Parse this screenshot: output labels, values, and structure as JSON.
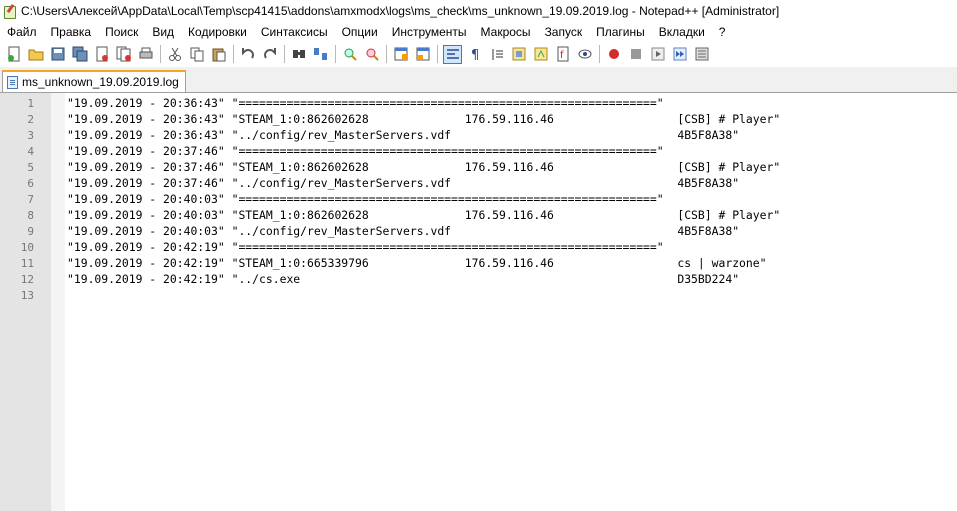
{
  "window": {
    "title": "C:\\Users\\Алексей\\AppData\\Local\\Temp\\scp41415\\addons\\amxmodx\\logs\\ms_check\\ms_unknown_19.09.2019.log - Notepad++ [Administrator]"
  },
  "menu": [
    "Файл",
    "Правка",
    "Поиск",
    "Вид",
    "Кодировки",
    "Синтаксисы",
    "Опции",
    "Инструменты",
    "Макросы",
    "Запуск",
    "Плагины",
    "Вкладки",
    "?"
  ],
  "toolbar_icons": [
    "new-file-icon",
    "open-file-icon",
    "save-icon",
    "save-all-icon",
    "close-icon",
    "close-all-icon",
    "print-icon",
    "|",
    "cut-icon",
    "copy-icon",
    "paste-icon",
    "|",
    "undo-icon",
    "redo-icon",
    "|",
    "find-icon",
    "replace-icon",
    "|",
    "zoom-in-icon",
    "zoom-out-icon",
    "|",
    "sync-vertical-icon",
    "sync-horizontal-icon",
    "|",
    "word-wrap-icon",
    "show-all-chars-icon",
    "indent-guide-icon",
    "document-map-icon",
    "function-list-icon",
    "folder-workspace-icon",
    "monitoring-icon",
    "|",
    "record-macro-icon",
    "stop-macro-icon",
    "play-macro-icon",
    "run-macro-multiple-icon",
    "save-macro-icon"
  ],
  "tab": {
    "label": "ms_unknown_19.09.2019.log"
  },
  "editor": {
    "lines": [
      {
        "n": "1",
        "text": "\"19.09.2019 - 20:36:43\" \"=============================================================\""
      },
      {
        "n": "2",
        "text": "\"19.09.2019 - 20:36:43\" \"STEAM_1:0:862602628              176.59.116.46                  [CSB] # Player\""
      },
      {
        "n": "3",
        "text": "\"19.09.2019 - 20:36:43\" \"../config/rev_MasterServers.vdf                                 4B5F8A38\""
      },
      {
        "n": "4",
        "text": "\"19.09.2019 - 20:37:46\" \"=============================================================\""
      },
      {
        "n": "5",
        "text": "\"19.09.2019 - 20:37:46\" \"STEAM_1:0:862602628              176.59.116.46                  [CSB] # Player\""
      },
      {
        "n": "6",
        "text": "\"19.09.2019 - 20:37:46\" \"../config/rev_MasterServers.vdf                                 4B5F8A38\""
      },
      {
        "n": "7",
        "text": "\"19.09.2019 - 20:40:03\" \"=============================================================\""
      },
      {
        "n": "8",
        "text": "\"19.09.2019 - 20:40:03\" \"STEAM_1:0:862602628              176.59.116.46                  [CSB] # Player\""
      },
      {
        "n": "9",
        "text": "\"19.09.2019 - 20:40:03\" \"../config/rev_MasterServers.vdf                                 4B5F8A38\""
      },
      {
        "n": "10",
        "text": "\"19.09.2019 - 20:42:19\" \"=============================================================\""
      },
      {
        "n": "11",
        "text": "\"19.09.2019 - 20:42:19\" \"STEAM_1:0:665339796              176.59.116.46                  cs | warzone\""
      },
      {
        "n": "12",
        "text": "\"19.09.2019 - 20:42:19\" \"../cs.exe                                                       D35BD224\""
      },
      {
        "n": "13",
        "text": ""
      }
    ]
  }
}
